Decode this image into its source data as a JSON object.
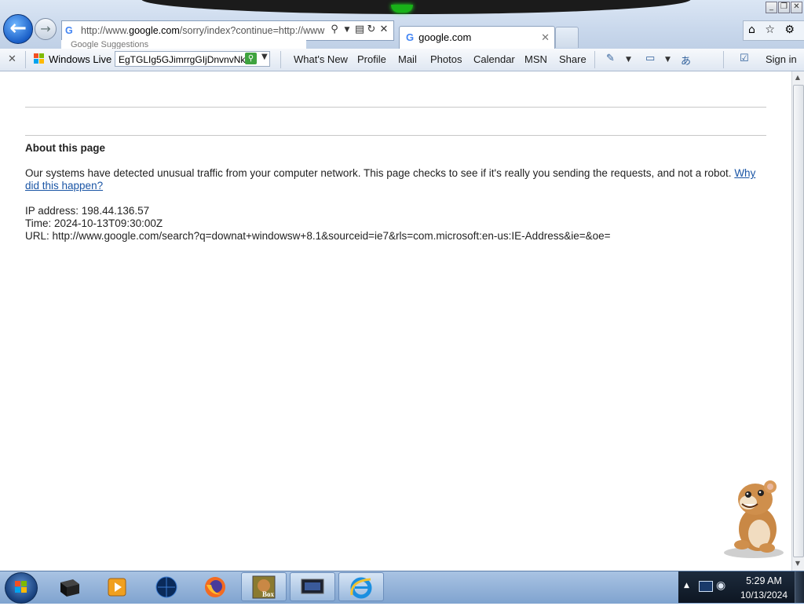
{
  "browser": {
    "address_url_prefix": "http://www.",
    "address_url_domain": "google.com",
    "address_url_rest": "/sorry/index?continue=http://www",
    "suggestions_hint": "Google Suggestions",
    "tab_title": "google.com",
    "tab_close": "✕",
    "back_glyph": "←",
    "colors": {
      "accent": "#1a5fc7",
      "link": "#1a55a5",
      "toolbar_bg": "#dfe7f2"
    }
  },
  "toolbar": {
    "close_glyph": "✕",
    "brand": "Windows Live",
    "search_value": "EgTGLIg5GJimrrgGIjDnvnvNk",
    "links": [
      "What's New",
      "Profile",
      "Mail",
      "Photos",
      "Calendar",
      "MSN",
      "Share"
    ],
    "sign_in": "Sign in"
  },
  "page": {
    "heading": "About this page",
    "message": "Our systems have detected unusual traffic from your computer network. This page checks to see if it's really you sending the requests, and not a robot.",
    "message_link": "Why did this happen?",
    "ip_line": "IP address: 198.44.136.57",
    "time_line": "Time: 2024-10-13T09:30:00Z",
    "url_line": "URL: http://www.google.com/search?q=downat+windowsw+8.1&sourceid=ie7&rls=com.microsoft:en-us:IE-Address&ie=&oe="
  },
  "taskbar": {
    "clock_time": "5:29 AM",
    "clock_date": "10/13/2024",
    "box_label": "Box"
  }
}
